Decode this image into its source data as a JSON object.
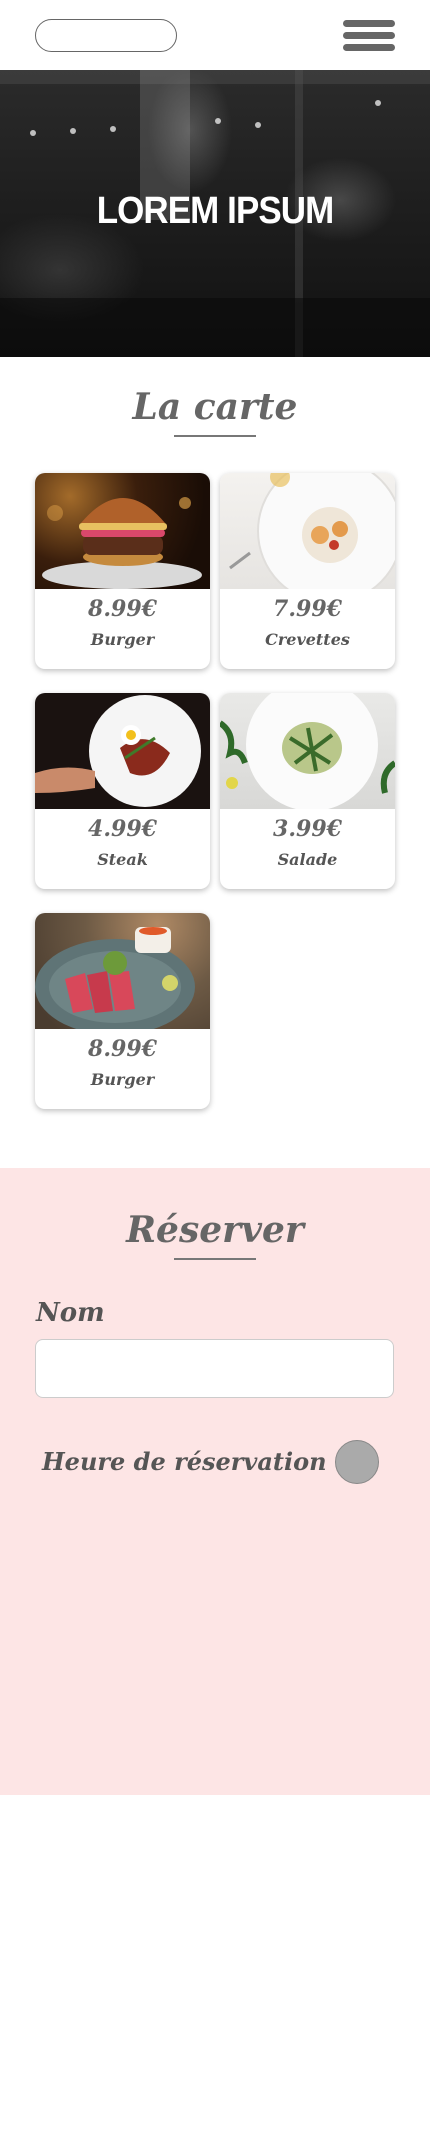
{
  "hero": {
    "title": "LOREM IPSUM"
  },
  "menu": {
    "title": "La carte",
    "items": [
      {
        "price": "8.99€",
        "name": "Burger",
        "photo": "burger-photo"
      },
      {
        "price": "7.99€",
        "name": "Crevettes",
        "photo": "shrimp-dish-photo"
      },
      {
        "price": "4.99€",
        "name": "Steak",
        "photo": "steak-plate-photo"
      },
      {
        "price": "3.99€",
        "name": "Salade",
        "photo": "salad-plate-photo"
      },
      {
        "price": "8.99€",
        "name": "Burger",
        "photo": "seared-tuna-photo"
      }
    ]
  },
  "reservation": {
    "title": "Réserver",
    "name_label": "Nom",
    "name_value": "",
    "time_label": "Heure de réservation"
  },
  "colors": {
    "accent_text": "#666666",
    "reservation_bg": "#fde5e5"
  }
}
